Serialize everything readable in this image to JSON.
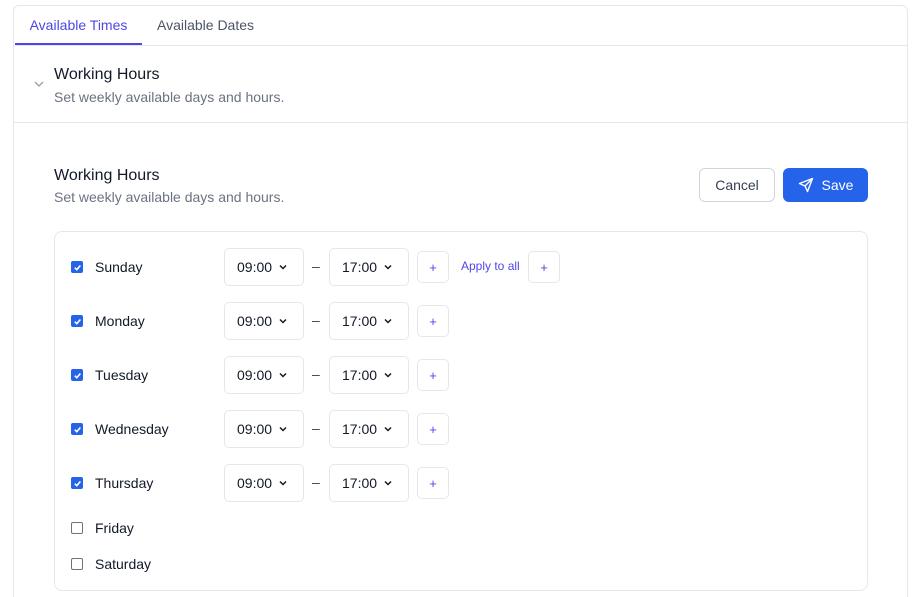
{
  "tabs": [
    {
      "label": "Available Times",
      "active": true
    },
    {
      "label": "Available Dates",
      "active": false
    }
  ],
  "collapsed_section": {
    "title": "Working Hours",
    "subtitle": "Set weekly available days and hours.",
    "icon": "chevron-down-icon"
  },
  "main": {
    "title": "Working Hours",
    "subtitle": "Set weekly available days and hours.",
    "cancel_label": "Cancel",
    "save_label": "Save",
    "save_icon": "send-icon",
    "apply_to_all_label": "Apply to all",
    "add_label": "+",
    "range_separator": "–"
  },
  "days": [
    {
      "name": "Sunday",
      "checked": true,
      "start": "09:00",
      "end": "17:00"
    },
    {
      "name": "Monday",
      "checked": true,
      "start": "09:00",
      "end": "17:00"
    },
    {
      "name": "Tuesday",
      "checked": true,
      "start": "09:00",
      "end": "17:00"
    },
    {
      "name": "Wednesday",
      "checked": true,
      "start": "09:00",
      "end": "17:00"
    },
    {
      "name": "Thursday",
      "checked": true,
      "start": "09:00",
      "end": "17:00"
    },
    {
      "name": "Friday",
      "checked": false
    },
    {
      "name": "Saturday",
      "checked": false
    }
  ],
  "colors": {
    "accent": "#4f46e5",
    "primary_button": "#2563eb",
    "border": "#e5e7eb"
  }
}
